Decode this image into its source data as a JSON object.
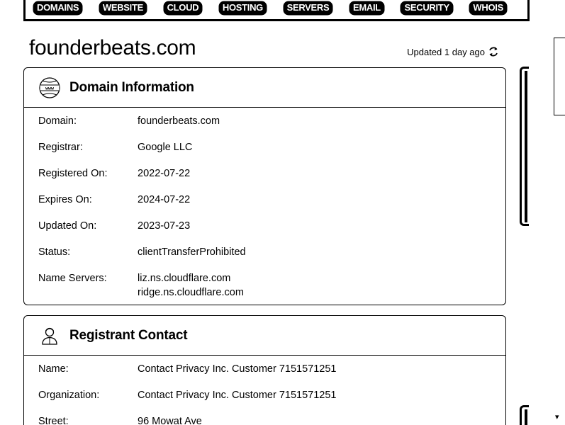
{
  "nav": {
    "items": [
      {
        "label": "DOMAINS"
      },
      {
        "label": "WEBSITE"
      },
      {
        "label": "CLOUD"
      },
      {
        "label": "HOSTING"
      },
      {
        "label": "SERVERS"
      },
      {
        "label": "EMAIL"
      },
      {
        "label": "SECURITY"
      },
      {
        "label": "WHOIS"
      }
    ]
  },
  "header": {
    "title": "founderbeats.com",
    "updated": "Updated 1 day ago",
    "refresh_icon": "refresh-icon"
  },
  "domain_info": {
    "title": "Domain Information",
    "icon": "www-icon",
    "rows": [
      {
        "label": "Domain:",
        "value": "founderbeats.com"
      },
      {
        "label": "Registrar:",
        "value": "Google LLC"
      },
      {
        "label": "Registered On:",
        "value": "2022-07-22"
      },
      {
        "label": "Expires On:",
        "value": "2024-07-22"
      },
      {
        "label": "Updated On:",
        "value": "2023-07-23"
      },
      {
        "label": "Status:",
        "value": "clientTransferProhibited"
      }
    ],
    "name_servers_label": "Name Servers:",
    "name_servers": [
      "liz.ns.cloudflare.com",
      "ridge.ns.cloudflare.com"
    ]
  },
  "registrant": {
    "title": "Registrant Contact",
    "icon": "user-icon",
    "rows": [
      {
        "label": "Name:",
        "value": "Contact Privacy Inc. Customer 7151571251"
      },
      {
        "label": "Organization:",
        "value": "Contact Privacy Inc. Customer 7151571251"
      },
      {
        "label": "Street:",
        "value": "96 Mowat Ave"
      }
    ]
  },
  "scroll_arrow": "▾"
}
